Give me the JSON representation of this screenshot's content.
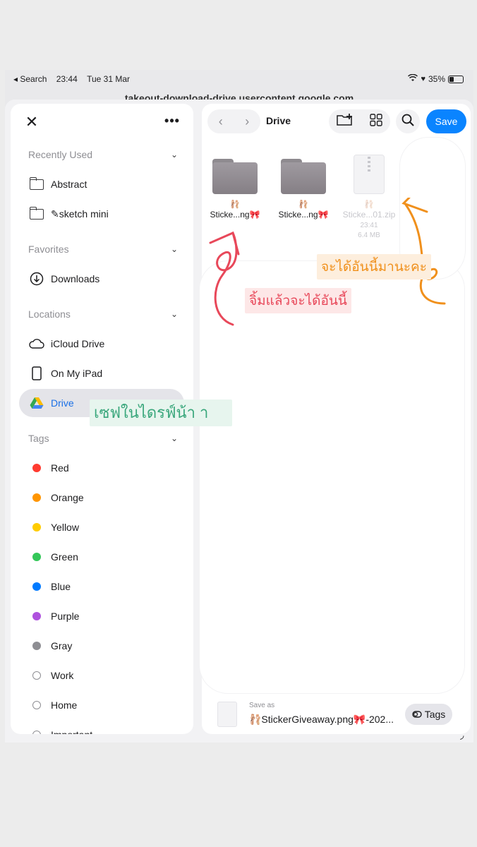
{
  "status_bar": {
    "back_label": "◂ Search",
    "time": "23:44",
    "date": "Tue 31 Mar",
    "battery": "35%"
  },
  "browser": {
    "url": "takeout-download-drive.usercontent.google.com"
  },
  "sidebar": {
    "sections": {
      "recently_used": "Recently Used",
      "favorites": "Favorites",
      "locations": "Locations",
      "tags": "Tags"
    },
    "recent": [
      {
        "label": "Abstract"
      },
      {
        "label": "✎sketch mini"
      }
    ],
    "favorites": [
      {
        "label": "Downloads"
      }
    ],
    "locations": [
      {
        "label": "iCloud Drive"
      },
      {
        "label": "On My iPad"
      },
      {
        "label": "Drive"
      }
    ],
    "tags": [
      {
        "label": "Red",
        "color": "#ff3b30"
      },
      {
        "label": "Orange",
        "color": "#ff9500"
      },
      {
        "label": "Yellow",
        "color": "#ffcc00"
      },
      {
        "label": "Green",
        "color": "#34c759"
      },
      {
        "label": "Blue",
        "color": "#007aff"
      },
      {
        "label": "Purple",
        "color": "#af52de"
      },
      {
        "label": "Gray",
        "color": "#8e8e93"
      },
      {
        "label": "Work",
        "color": "ring"
      },
      {
        "label": "Home",
        "color": "ring"
      },
      {
        "label": "Important",
        "color": "ring"
      }
    ]
  },
  "toolbar": {
    "title": "Drive",
    "save_label": "Save"
  },
  "files": [
    {
      "emoji": "🩰",
      "name": "Sticke...ng🎀",
      "type": "folder"
    },
    {
      "emoji": "🩰",
      "name": "Sticke...ng🎀",
      "type": "folder"
    },
    {
      "emoji": "🩰",
      "name": "Sticke...01.zip",
      "time": "23:41",
      "size": "6.4 MB",
      "type": "zip"
    }
  ],
  "annotations": {
    "orange": "จะได้อันนี้มานะคะ",
    "pink": "จิ้มแล้วจะได้อันนี้",
    "green": "เซฟในไดรฟ์น้า า"
  },
  "save_bar": {
    "label": "Save as",
    "filename": "🩰StickerGiveaway.png🎀-202...",
    "tags_label": "Tags"
  },
  "colors": {
    "accent": "#0a84ff",
    "selected_text": "#1a6fe6"
  }
}
